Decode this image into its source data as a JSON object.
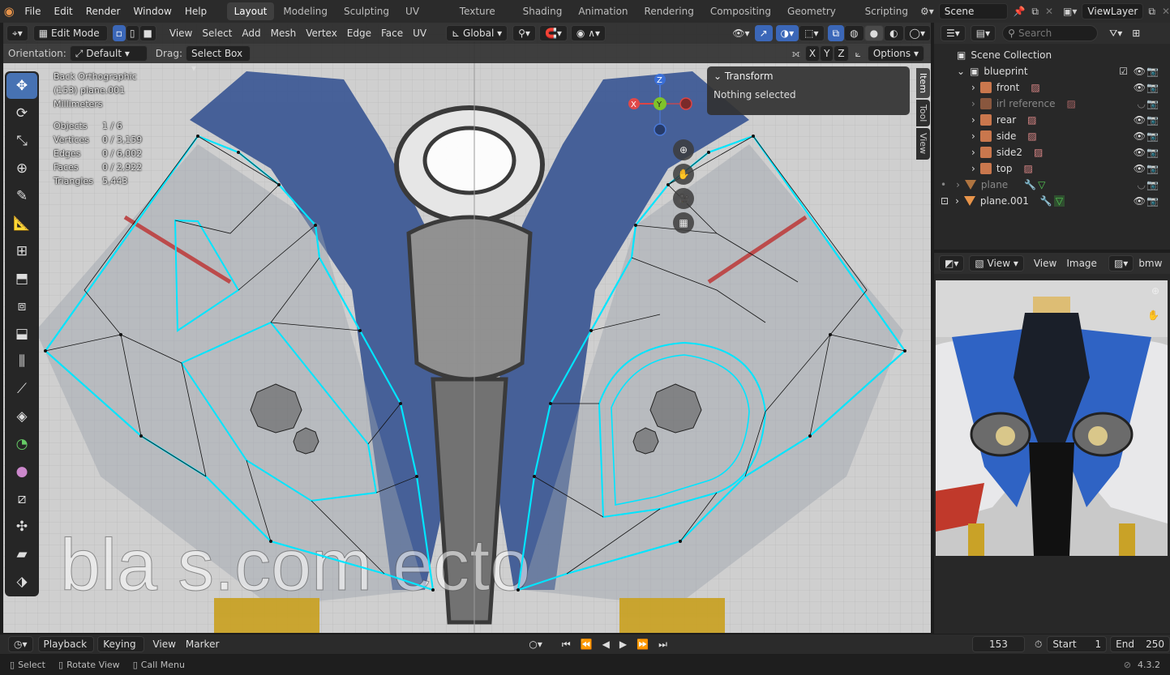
{
  "menubar": {
    "menus": [
      "File",
      "Edit",
      "Render",
      "Window",
      "Help"
    ],
    "workspaces": [
      "Layout",
      "Modeling",
      "Sculpting",
      "UV Editing",
      "Texture Paint",
      "Shading",
      "Animation",
      "Rendering",
      "Compositing",
      "Geometry Nodes",
      "Scripting"
    ],
    "active_workspace": "Layout",
    "scene": "Scene",
    "view_layer": "ViewLayer"
  },
  "viewport_header": {
    "mode": "Edit Mode",
    "menus": [
      "View",
      "Select",
      "Add",
      "Mesh",
      "Vertex",
      "Edge",
      "Face",
      "UV"
    ],
    "transform_orientation": "Global",
    "orientation_label": "Orientation:",
    "orientation_value": "Default",
    "drag_label": "Drag:",
    "drag_value": "Select Box",
    "axes": [
      "X",
      "Y",
      "Z"
    ],
    "options_label": "Options"
  },
  "overlay": {
    "view_name": "Back Orthographic",
    "object_name": "(153) plane.001",
    "units": "Millimeters",
    "stats": [
      {
        "label": "Objects",
        "value": "1 / 6"
      },
      {
        "label": "Vertices",
        "value": "0 / 3,159"
      },
      {
        "label": "Edges",
        "value": "0 / 6,002"
      },
      {
        "label": "Faces",
        "value": "0 / 2,922"
      },
      {
        "label": "Triangles",
        "value": "5,443"
      }
    ]
  },
  "transform_panel": {
    "title": "Transform",
    "message": "Nothing selected"
  },
  "side_tabs": [
    "Item",
    "Tool",
    "View"
  ],
  "gizmo": {
    "x": "X",
    "y": "Y",
    "z": "Z"
  },
  "outliner": {
    "search_placeholder": "Search",
    "root": "Scene Collection",
    "collection": "blueprint",
    "items": [
      {
        "name": "front",
        "dim": false
      },
      {
        "name": "irl reference",
        "dim": true
      },
      {
        "name": "rear",
        "dim": false
      },
      {
        "name": "side",
        "dim": false
      },
      {
        "name": "side2",
        "dim": false
      },
      {
        "name": "top",
        "dim": false
      }
    ],
    "objects": [
      {
        "name": "plane",
        "dim": true
      },
      {
        "name": "plane.001",
        "dim": false
      }
    ]
  },
  "image_editor": {
    "view_menu": "View",
    "view2": "View",
    "image_menu": "Image",
    "image_name": "bmw"
  },
  "timeline": {
    "menus": [
      "Playback",
      "Keying",
      "View",
      "Marker"
    ],
    "current_frame": "153",
    "start_label": "Start",
    "start": "1",
    "end_label": "End",
    "end": "250"
  },
  "statusbar": {
    "select": "Select",
    "rotate": "Rotate View",
    "menu": "Call Menu",
    "version": "4.3.2"
  },
  "watermark": "bla    s.com   ecto",
  "colors": {
    "accent": "#4772b3",
    "wire": "#00e5ff",
    "bg": "#1d1d1d",
    "blue_fairing": "#3f5b96"
  }
}
